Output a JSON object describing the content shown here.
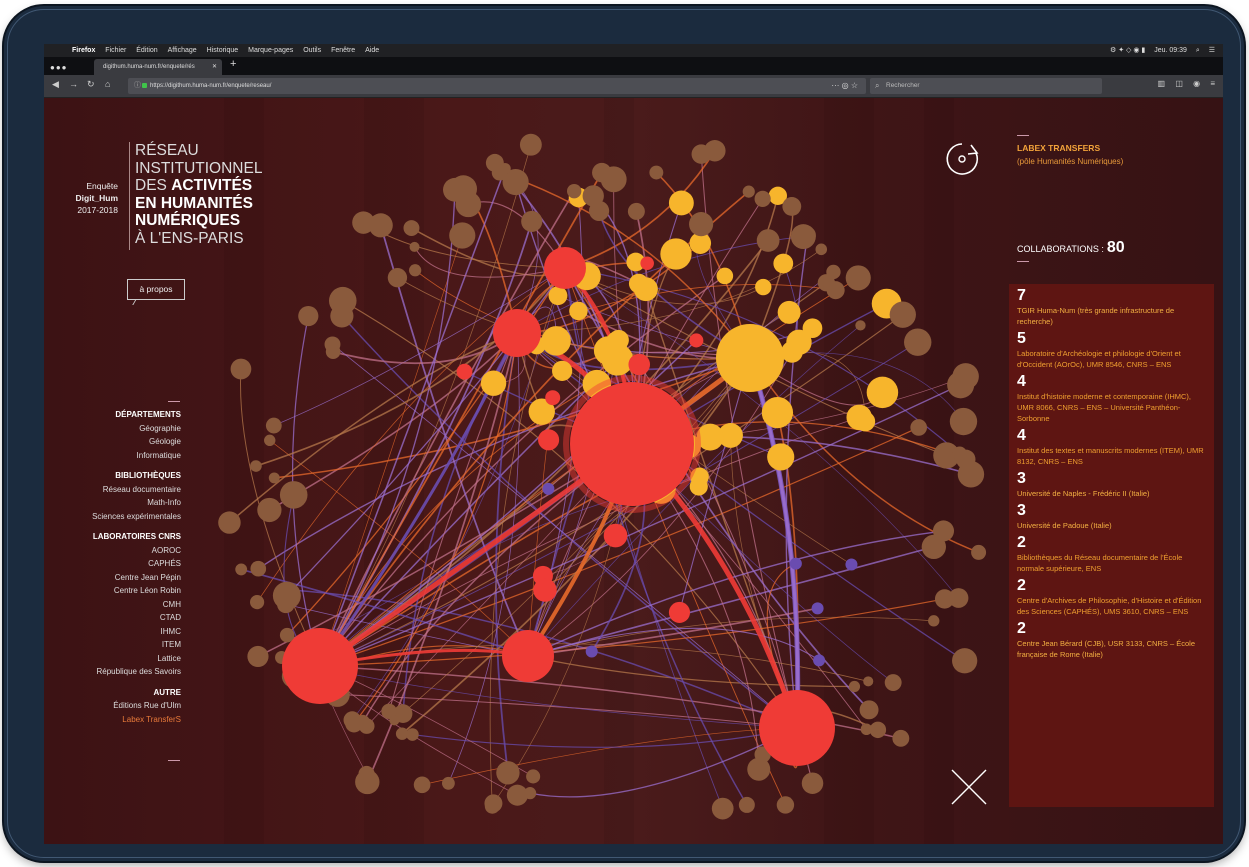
{
  "macos": {
    "app": "Firefox",
    "menus": [
      "Fichier",
      "Édition",
      "Affichage",
      "Historique",
      "Marque-pages",
      "Outils",
      "Fenêtre",
      "Aide"
    ],
    "clock": "Jeu. 09:39"
  },
  "browser": {
    "tab_title": "digithum.huma-num.fr/enquete/rés",
    "url": "https://digithum.huma-num.fr/enquete/reseau/",
    "search_placeholder": "Rechercher"
  },
  "page": {
    "enquete_lines": [
      "Enquête",
      "Digit_Hum",
      "2017-2018"
    ],
    "title_lines": [
      "RÉSEAU",
      "INSTITUTIONNEL",
      "DES ",
      "ACTIVITÉS",
      "EN HUMANITÉS",
      "NUMÉRIQUES",
      "À L'ENS-PARIS"
    ],
    "apropos": "à propos",
    "nav": [
      {
        "heading": "DÉPARTEMENTS",
        "items": [
          "Géographie",
          "Géologie",
          "Informatique"
        ]
      },
      {
        "heading": "BIBLIOTHÈQUES",
        "items": [
          "Réseau documentaire",
          "Math-Info",
          "Sciences expérimentales"
        ]
      },
      {
        "heading": "LABORATOIRES CNRS",
        "items": [
          "AOROC",
          "CAPHÉS",
          "Centre Jean Pépin",
          "Centre Léon Robin",
          "CMH",
          "CTAD",
          "IHMC",
          "ITEM",
          "Lattice",
          "République des Savoirs"
        ]
      },
      {
        "heading": "AUTRE",
        "items": [
          "Éditions Rue d'Ulm",
          "Labex TransferS"
        ]
      }
    ],
    "selected": {
      "title": "LABEX TRANSFERS",
      "subtitle": "(pôle Humanités Numériques)",
      "collab_label": "COLLABORATIONS :",
      "collab_count": "80"
    },
    "collaborations": [
      {
        "n": "7",
        "t": "TGIR Huma-Num (très grande infrastructure de recherche)"
      },
      {
        "n": "5",
        "t": "Laboratoire d'Archéologie et philologie d'Orient et d'Occident (AOrOc), UMR 8546, CNRS – ENS"
      },
      {
        "n": "4",
        "t": "Institut d'histoire moderne et contemporaine (IHMC), UMR 8066, CNRS – ENS – Université Panthéon-Sorbonne"
      },
      {
        "n": "4",
        "t": "Institut des textes et manuscrits modernes (ITEM), UMR 8132, CNRS – ENS"
      },
      {
        "n": "3",
        "t": "Université de Naples - Frédéric II (Italie)"
      },
      {
        "n": "3",
        "t": "Université de Padoue (Italie)"
      },
      {
        "n": "2",
        "t": "Bibliothèques du Réseau documentaire de l'École normale supérieure, ENS"
      },
      {
        "n": "2",
        "t": "Centre d'Archives de Philosophie, d'Histoire et d'Édition des Sciences (CAPHÉS), UMS 3610, CNRS – ENS"
      },
      {
        "n": "2",
        "t": "Centre Jean Bérard (CJB), USR 3133, CNRS – École française de Rome (Italie)"
      }
    ]
  },
  "colors": {
    "red": "#ef3b36",
    "yellow": "#f7b52c",
    "brown": "#8a5a3c",
    "purple": "#6a4cb0",
    "orange": "#e86a2b"
  }
}
